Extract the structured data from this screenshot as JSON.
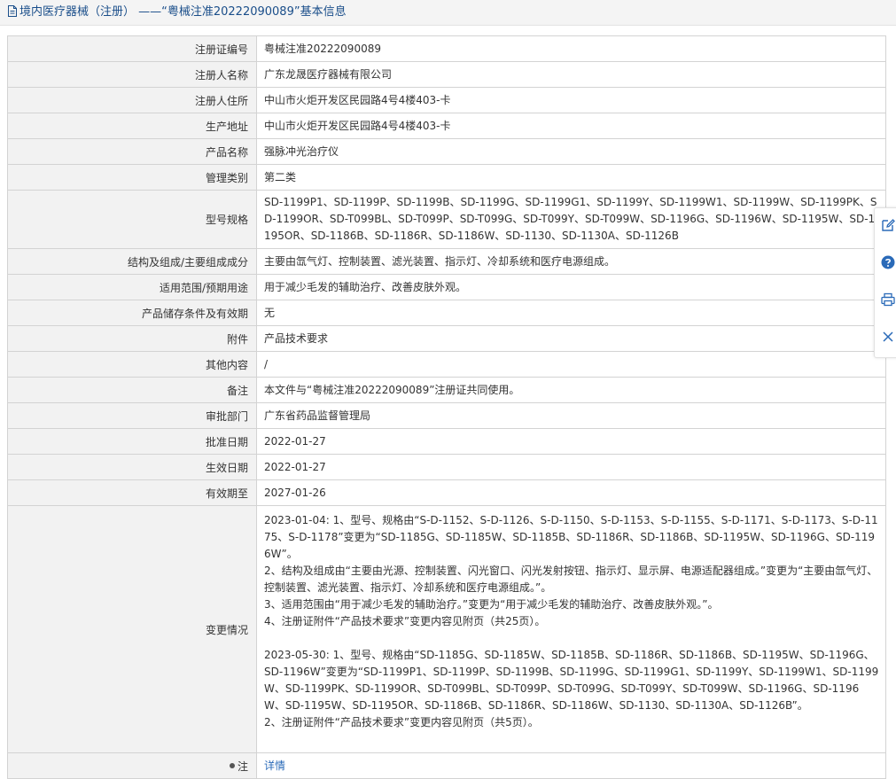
{
  "header": {
    "title": "境内医疗器械（注册） ——“粤械注准20222090089”基本信息"
  },
  "rows": [
    {
      "label": "注册证编号",
      "value": "粤械注准20222090089"
    },
    {
      "label": "注册人名称",
      "value": "广东龙晟医疗器械有限公司"
    },
    {
      "label": "注册人住所",
      "value": "中山市火炬开发区民园路4号4楼403-卡"
    },
    {
      "label": "生产地址",
      "value": "中山市火炬开发区民园路4号4楼403-卡"
    },
    {
      "label": "产品名称",
      "value": "强脉冲光治疗仪"
    },
    {
      "label": "管理类别",
      "value": "第二类"
    },
    {
      "label": "型号规格",
      "value": "SD-1199P1、SD-1199P、SD-1199B、SD-1199G、SD-1199G1、SD-1199Y、SD-1199W1、SD-1199W、SD-1199PK、SD-1199OR、SD-T099BL、SD-T099P、SD-T099G、SD-T099Y、SD-T099W、SD-1196G、SD-1196W、SD-1195W、SD-1195OR、SD-1186B、SD-1186R、SD-1186W、SD-1130、SD-1130A、SD-1126B"
    },
    {
      "label": "结构及组成/主要组成成分",
      "value": "主要由氙气灯、控制装置、滤光装置、指示灯、冷却系统和医疗电源组成。"
    },
    {
      "label": "适用范围/预期用途",
      "value": "用于减少毛发的辅助治疗、改善皮肤外观。"
    },
    {
      "label": "产品储存条件及有效期",
      "value": "无"
    },
    {
      "label": "附件",
      "value": "产品技术要求"
    },
    {
      "label": "其他内容",
      "value": "/"
    },
    {
      "label": "备注",
      "value": "本文件与“粤械注准20222090089”注册证共同使用。"
    },
    {
      "label": "审批部门",
      "value": "广东省药品监督管理局"
    },
    {
      "label": "批准日期",
      "value": "2022-01-27"
    },
    {
      "label": "生效日期",
      "value": "2022-01-27"
    },
    {
      "label": "有效期至",
      "value": "2027-01-26"
    }
  ],
  "change": {
    "label": "变更情况",
    "block1": [
      "2023-01-04: 1、型号、规格由“S-D-1152、S-D-1126、S-D-1150、S-D-1153、S-D-1155、S-D-1171、S-D-1173、S-D-1175、S-D-1178”变更为“SD-1185G、SD-1185W、SD-1185B、SD-1186R、SD-1186B、SD-1195W、SD-1196G、SD-1196W”。",
      "2、结构及组成由“主要由光源、控制装置、闪光窗口、闪光发射按钮、指示灯、显示屏、电源适配器组成。”变更为“主要由氙气灯、控制装置、滤光装置、指示灯、冷却系统和医疗电源组成。”。",
      "3、适用范围由“用于减少毛发的辅助治疗。”变更为“用于减少毛发的辅助治疗、改善皮肤外观。”。",
      "4、注册证附件“产品技术要求”变更内容见附页（共25页）。"
    ],
    "block2": [
      "2023-05-30: 1、型号、规格由“SD-1185G、SD-1185W、SD-1185B、SD-1186R、SD-1186B、SD-1195W、SD-1196G、SD-1196W”变更为“SD-1199P1、SD-1199P、SD-1199B、SD-1199G、SD-1199G1、SD-1199Y、SD-1199W1、SD-1199W、SD-1199PK、SD-1199OR、SD-T099BL、SD-T099P、SD-T099G、SD-T099Y、SD-T099W、SD-1196G、SD-1196W、SD-1195W、SD-1195OR、SD-1186B、SD-1186R、SD-1186W、SD-1130、SD-1130A、SD-1126B”。",
      "2、注册证附件“产品技术要求”变更内容见附页（共5页）。"
    ]
  },
  "note": {
    "label": "注",
    "link": "详情"
  },
  "sidebar": {
    "icons": [
      "edit-icon",
      "help-icon",
      "print-icon",
      "close-icon"
    ]
  },
  "colors": {
    "title": "#1a4e8a",
    "key_bg": "#f2f2f2",
    "border": "#d3d3d3",
    "link": "#2a6ab8"
  }
}
